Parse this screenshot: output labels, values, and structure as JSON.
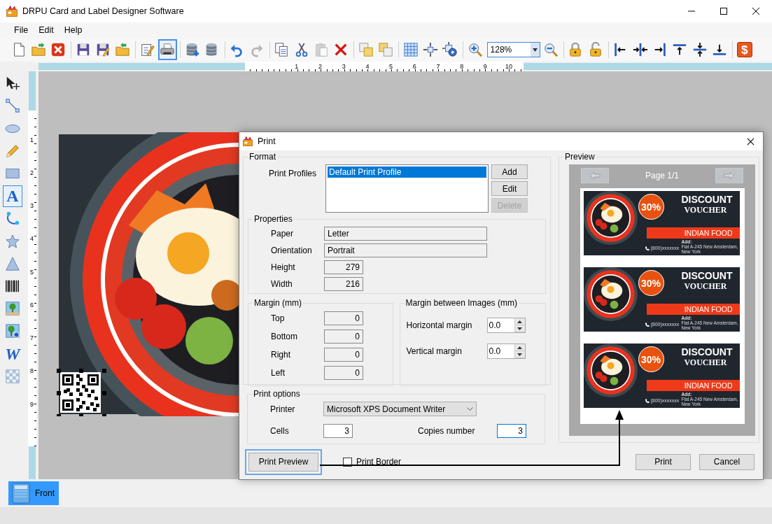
{
  "window": {
    "title": "DRPU Card and Label Designer Software"
  },
  "menu": [
    {
      "label": "File"
    },
    {
      "label": "Edit"
    },
    {
      "label": "Help"
    }
  ],
  "toolbar": [
    {
      "kind": "new",
      "selected": false,
      "disabled": false
    },
    {
      "kind": "open",
      "selected": false,
      "disabled": false
    },
    {
      "kind": "close",
      "selected": false,
      "disabled": false
    },
    {
      "kind": "separator"
    },
    {
      "kind": "save",
      "selected": false,
      "disabled": false
    },
    {
      "kind": "save_as",
      "selected": false,
      "disabled": false
    },
    {
      "kind": "export",
      "selected": false,
      "disabled": false
    },
    {
      "kind": "separator"
    },
    {
      "kind": "edit",
      "selected": false,
      "disabled": false
    },
    {
      "kind": "print",
      "selected": true,
      "disabled": false
    },
    {
      "kind": "separator"
    },
    {
      "kind": "db_add",
      "selected": false,
      "disabled": false
    },
    {
      "kind": "db",
      "selected": false,
      "disabled": false
    },
    {
      "kind": "separator"
    },
    {
      "kind": "undo",
      "selected": false,
      "disabled": false
    },
    {
      "kind": "redo",
      "selected": false,
      "disabled": true
    },
    {
      "kind": "separator"
    },
    {
      "kind": "copy",
      "selected": false,
      "disabled": false
    },
    {
      "kind": "cut",
      "selected": false,
      "disabled": false
    },
    {
      "kind": "paste",
      "selected": false,
      "disabled": true
    },
    {
      "kind": "delete",
      "selected": false,
      "disabled": false
    },
    {
      "kind": "separator"
    },
    {
      "kind": "front",
      "selected": false,
      "disabled": false
    },
    {
      "kind": "back",
      "selected": false,
      "disabled": false
    },
    {
      "kind": "separator"
    },
    {
      "kind": "grid",
      "selected": false,
      "disabled": false
    },
    {
      "kind": "center",
      "selected": false,
      "disabled": false
    },
    {
      "kind": "fit",
      "selected": false,
      "disabled": false
    },
    {
      "kind": "separator"
    },
    {
      "kind": "zoom_in",
      "selected": false,
      "disabled": false
    },
    {
      "kind": "zoom",
      "value": "128%"
    },
    {
      "kind": "zoom_out",
      "selected": false,
      "disabled": false
    },
    {
      "kind": "separator"
    },
    {
      "kind": "lock",
      "selected": false,
      "disabled": false
    },
    {
      "kind": "unlock",
      "selected": false,
      "disabled": false
    },
    {
      "kind": "separator"
    },
    {
      "kind": "align_left",
      "selected": false,
      "disabled": false
    },
    {
      "kind": "align_center",
      "selected": false,
      "disabled": false
    },
    {
      "kind": "align_right",
      "selected": false,
      "disabled": false
    },
    {
      "kind": "align_top",
      "selected": false,
      "disabled": false
    },
    {
      "kind": "align_middle",
      "selected": false,
      "disabled": false
    },
    {
      "kind": "align_bottom",
      "selected": false,
      "disabled": false
    },
    {
      "kind": "separator"
    },
    {
      "kind": "purchase",
      "glyph": "$",
      "selected": false,
      "disabled": false
    }
  ],
  "rulers": {
    "horizontal": [
      "1",
      "2",
      "3",
      "4",
      "5",
      "6",
      "7",
      "8",
      "9",
      "10"
    ],
    "vertical": [
      "1",
      "2",
      "3",
      "4",
      "5",
      "6",
      "7",
      "8",
      "9"
    ]
  },
  "tools": [
    {
      "kind": "select",
      "selected": false
    },
    {
      "kind": "line",
      "selected": false
    },
    {
      "kind": "ellipse",
      "selected": false
    },
    {
      "kind": "pencil",
      "selected": false
    },
    {
      "kind": "rectangle",
      "selected": false
    },
    {
      "kind": "text",
      "glyph": "A",
      "selected": true
    },
    {
      "kind": "curve",
      "selected": false
    },
    {
      "kind": "star",
      "selected": false
    },
    {
      "kind": "triangle",
      "selected": false
    },
    {
      "kind": "barcode",
      "selected": false
    },
    {
      "kind": "image",
      "selected": false
    },
    {
      "kind": "watermark",
      "selected": false
    },
    {
      "kind": "wordart",
      "glyph": "W",
      "selected": false
    },
    {
      "kind": "pattern",
      "selected": false
    }
  ],
  "page_tabs": [
    {
      "label": "Front",
      "selected": true
    }
  ],
  "print_dialog": {
    "title": "Print",
    "format": {
      "legend": "Format",
      "profiles_label": "Print Profiles",
      "profiles": [
        {
          "label": "Default Print Profile",
          "selected": true
        }
      ],
      "buttons": [
        {
          "label": "Add",
          "disabled": false
        },
        {
          "label": "Edit",
          "disabled": false
        },
        {
          "label": "Delete",
          "disabled": true
        }
      ]
    },
    "properties": {
      "legend": "Properties",
      "fields": [
        {
          "label": "Paper",
          "value": "Letter",
          "kind": "text"
        },
        {
          "label": "Orientation",
          "value": "Portrait",
          "kind": "text"
        },
        {
          "label": "Height",
          "value": "279",
          "kind": "number"
        },
        {
          "label": "Width",
          "value": "216",
          "kind": "number"
        }
      ]
    },
    "margin": {
      "legend": "Margin (mm)",
      "fields": [
        {
          "label": "Top",
          "value": "0"
        },
        {
          "label": "Bottom",
          "value": "0"
        },
        {
          "label": "Right",
          "value": "0"
        },
        {
          "label": "Left",
          "value": "0"
        }
      ]
    },
    "margin_between": {
      "legend": "Margin between Images (mm)",
      "fields": [
        {
          "label": "Horizontal margin",
          "value": "0.0"
        },
        {
          "label": "Vertical margin",
          "value": "0.0"
        }
      ]
    },
    "print_options": {
      "legend": "Print options",
      "printer_label": "Printer",
      "printer": "Microsoft XPS Document Writer",
      "cells_label": "Cells",
      "cells": "3",
      "copies_label": "Copies number",
      "copies": "3",
      "copies_focused": true
    },
    "print_preview": {
      "label": "Print Preview",
      "focused": true
    },
    "print_border": {
      "label": "Print Border",
      "checked": false
    },
    "buttons": [
      {
        "label": "Print"
      },
      {
        "label": "Cancel"
      }
    ],
    "preview": {
      "legend": "Preview",
      "page": "Page 1/1",
      "cards": [
        {
          "badge": "30%",
          "title": "DISCOUNT",
          "subtitle": "VOUCHER",
          "band": "INDIAN FOOD",
          "phone": "(800)xxxxxxx",
          "address_label": "Add:",
          "address": "Flat A-245 New Amsterdam, New York"
        },
        {
          "badge": "30%",
          "title": "DISCOUNT",
          "subtitle": "VOUCHER",
          "band": "INDIAN FOOD",
          "phone": "(800)xxxxxxx",
          "address_label": "Add:",
          "address": "Flat A-245 New Amsterdam, New York"
        },
        {
          "badge": "30%",
          "title": "DISCOUNT",
          "subtitle": "VOUCHER",
          "band": "INDIAN FOOD",
          "phone": "(800)xxxxxxx",
          "address_label": "Add:",
          "address": "Flat A-245 New Amsterdam, New York"
        }
      ]
    }
  }
}
